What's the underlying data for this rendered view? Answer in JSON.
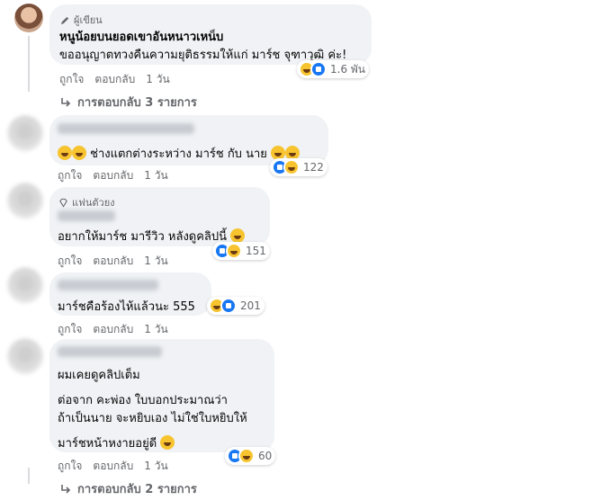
{
  "comments": [
    {
      "badge": "ผู้เขียน",
      "author": "หนูน้อยบนยอดเขาอันหนาวเหน็บ",
      "text": "ขออนุญาตทวงคืนความยุติธรรมให้แก่ มาร์ช จุฑาวุฒิ ค่ะ!",
      "like": "ถูกใจ",
      "reply": "ตอบกลับ",
      "time": "1 วัน",
      "reaction_count": "1.6 พัน",
      "replies_link": "การตอบกลับ 3 รายการ"
    },
    {
      "text": "ช่างแตกต่างระหว่าง มาร์ช กับ นาย",
      "like": "ถูกใจ",
      "reply": "ตอบกลับ",
      "time": "1 วัน",
      "reaction_count": "122"
    },
    {
      "badge": "แฟนตัวยง",
      "text": "อยากให้มาร์ช มารีวิว หลังดูคลิปนี้",
      "like": "ถูกใจ",
      "reply": "ตอบกลับ",
      "time": "1 วัน",
      "reaction_count": "151"
    },
    {
      "text": "มาร์ชคือร้องไห้แล้วนะ 555",
      "like": "ถูกใจ",
      "reply": "ตอบกลับ",
      "time": "1 วัน",
      "reaction_count": "201"
    },
    {
      "lines": [
        "ผมเคยดูคลิปเต็ม",
        "ต่อจาก คะพ่อง ใบบอกประมาณว่า",
        "ถ้าเป็นนาย จะหยิบเอง ไม่ใช่ใบหยิบให้",
        "มาร์ชหน้าหงายอยู่ดี"
      ],
      "like": "ถูกใจ",
      "reply": "ตอบกลับ",
      "time": "1 วัน",
      "reaction_count": "60",
      "replies_link": "การตอบกลับ 2 รายการ"
    }
  ],
  "colors": {
    "bubble": "#f0f2f5",
    "meta": "#65676b",
    "like_blue": "#1877f2",
    "haha_yellow": "#f7c42f"
  },
  "icons": [
    "pencil-icon",
    "diamond-icon",
    "reply-arrow-icon",
    "like-reaction-icon",
    "haha-reaction-icon",
    "laughing-emoji-icon",
    "shocked-emoji-icon"
  ]
}
